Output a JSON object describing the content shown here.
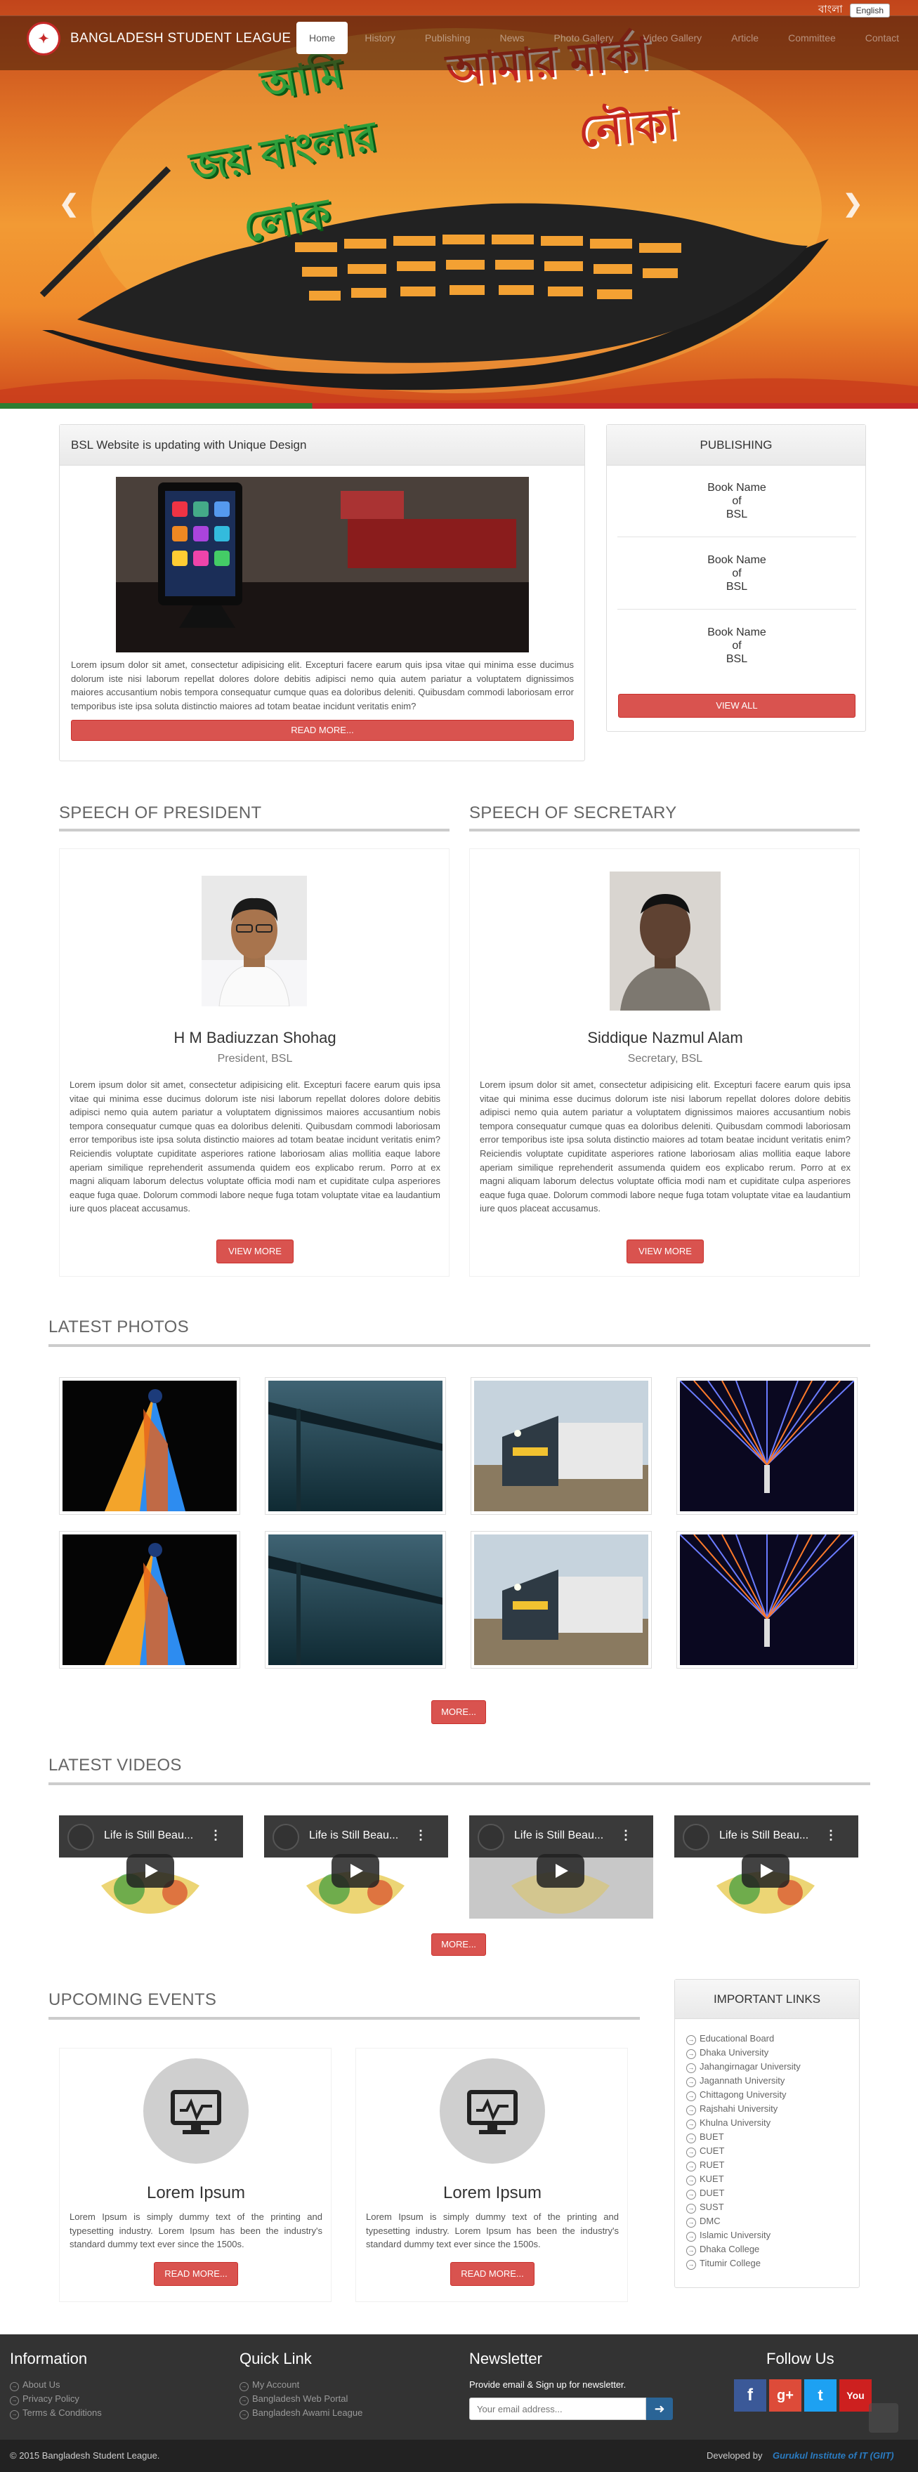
{
  "lang": {
    "bangla": "বাংলা",
    "english": "English"
  },
  "brand": {
    "name": "BANGLADESH STUDENT LEAGUE"
  },
  "nav": [
    "Home",
    "History",
    "Publishing",
    "News",
    "Photo Gallery",
    "Video Gallery",
    "Article",
    "Committee",
    "Contact"
  ],
  "hero": {
    "line1": "আমি",
    "line2": "জয় বাংলার",
    "line3": "লোক",
    "line4": "আমার মার্কা",
    "line5": "নৌকা"
  },
  "news": {
    "title": "BSL Website is updating with Unique Design",
    "text": "Lorem ipsum dolor sit amet, consectetur adipisicing elit. Excepturi facere earum quis ipsa vitae qui minima esse ducimus dolorum iste nisi laborum repellat dolores dolore debitis adipisci nemo quia autem pariatur a voluptatem dignissimos maiores accusantium nobis tempora consequatur cumque quas ea doloribus deleniti. Quibusdam commodi laboriosam error temporibus iste ipsa soluta distinctio maiores ad totam beatae incidunt veritatis enim?",
    "button": "READ MORE..."
  },
  "publishing": {
    "title": "PUBLISHING",
    "items": [
      {
        "l1": "Book Name",
        "l2": "of",
        "l3": "BSL"
      },
      {
        "l1": "Book Name",
        "l2": "of",
        "l3": "BSL"
      },
      {
        "l1": "Book Name",
        "l2": "of",
        "l3": "BSL"
      }
    ],
    "button": "VIEW ALL"
  },
  "president": {
    "heading": "SPEECH OF PRESIDENT",
    "name": "H M Badiuzzan Shohag",
    "role": "President, BSL",
    "text": "Lorem ipsum dolor sit amet, consectetur adipisicing elit. Excepturi facere earum quis ipsa vitae qui minima esse ducimus dolorum iste nisi laborum repellat dolores dolore debitis adipisci nemo quia autem pariatur a voluptatem dignissimos maiores accusantium nobis tempora consequatur cumque quas ea doloribus deleniti. Quibusdam commodi laboriosam error temporibus iste ipsa soluta distinctio maiores ad totam beatae incidunt veritatis enim? Reiciendis voluptate cupiditate asperiores ratione laboriosam alias mollitia eaque labore aperiam similique reprehenderit assumenda quidem eos explicabo rerum. Porro at ex magni aliquam laborum delectus voluptate officia modi nam et cupiditate culpa asperiores eaque fuga quae. Dolorum commodi labore neque fuga totam voluptate vitae ea laudantium iure quos placeat accusamus.",
    "button": "VIEW MORE"
  },
  "secretary": {
    "heading": "SPEECH OF SECRETARY",
    "name": "Siddique Nazmul Alam",
    "role": "Secretary, BSL",
    "text": "Lorem ipsum dolor sit amet, consectetur adipisicing elit. Excepturi facere earum quis ipsa vitae qui minima esse ducimus dolorum iste nisi laborum repellat dolores dolore debitis adipisci nemo quia autem pariatur a voluptatem dignissimos maiores accusantium nobis tempora consequatur cumque quas ea doloribus deleniti. Quibusdam commodi laboriosam error temporibus iste ipsa soluta distinctio maiores ad totam beatae incidunt veritatis enim? Reiciendis voluptate cupiditate asperiores ratione laboriosam alias mollitia eaque labore aperiam similique reprehenderit assumenda quidem eos explicabo rerum. Porro at ex magni aliquam laborum delectus voluptate officia modi nam et cupiditate culpa asperiores eaque fuga quae. Dolorum commodi labore neque fuga totam voluptate vitae ea laudantium iure quos placeat accusamus.",
    "button": "VIEW MORE"
  },
  "photos": {
    "heading": "LATEST PHOTOS",
    "button": "MORE..."
  },
  "videos": {
    "heading": "LATEST VIDEOS",
    "video_title": "Life is Still Beau...",
    "button": "MORE..."
  },
  "events": {
    "heading": "UPCOMING EVENTS",
    "items": [
      {
        "title": "Lorem Ipsum",
        "text": "Lorem Ipsum is simply dummy text of the printing and typesetting industry. Lorem Ipsum has been the industry's standard dummy text ever since the 1500s.",
        "button": "READ MORE..."
      },
      {
        "title": "Lorem Ipsum",
        "text": "Lorem Ipsum is simply dummy text of the printing and typesetting industry. Lorem Ipsum has been the industry's standard dummy text ever since the 1500s.",
        "button": "READ MORE..."
      }
    ]
  },
  "important_links": {
    "title": "IMPORTANT LINKS",
    "items": [
      "Educational Board",
      "Dhaka University",
      "Jahangirnagar University",
      "Jagannath University",
      "Chittagong University",
      "Rajshahi University",
      "Khulna University",
      "BUET",
      "CUET",
      "RUET",
      "KUET",
      "DUET",
      "SUST",
      "DMC",
      "Islamic University",
      "Dhaka College",
      "Titumir College"
    ]
  },
  "footer": {
    "info_title": "Information",
    "info_items": [
      "About Us",
      "Privacy Policy",
      "Terms & Conditions"
    ],
    "quick_title": "Quick Link",
    "quick_items": [
      "My Account",
      "Bangladesh Web Portal",
      "Bangladesh Awami League"
    ],
    "newsletter_title": "Newsletter",
    "newsletter_text": "Provide email & Sign up for newsletter.",
    "email_placeholder": "Your email address...",
    "follow_title": "Follow Us",
    "copyright": "© 2015 Bangladesh Student League.",
    "developed_by": "Developed by",
    "developer": "Gurukul Institute of IT (GIIT)"
  },
  "colors": {
    "accent": "#d9534f",
    "footer_bg": "#333333",
    "facebook": "#3b5998",
    "google": "#dd4b39",
    "twitter": "#1da1f2",
    "youtube": "#cd201f",
    "developer_link": "#2a7bc1"
  }
}
